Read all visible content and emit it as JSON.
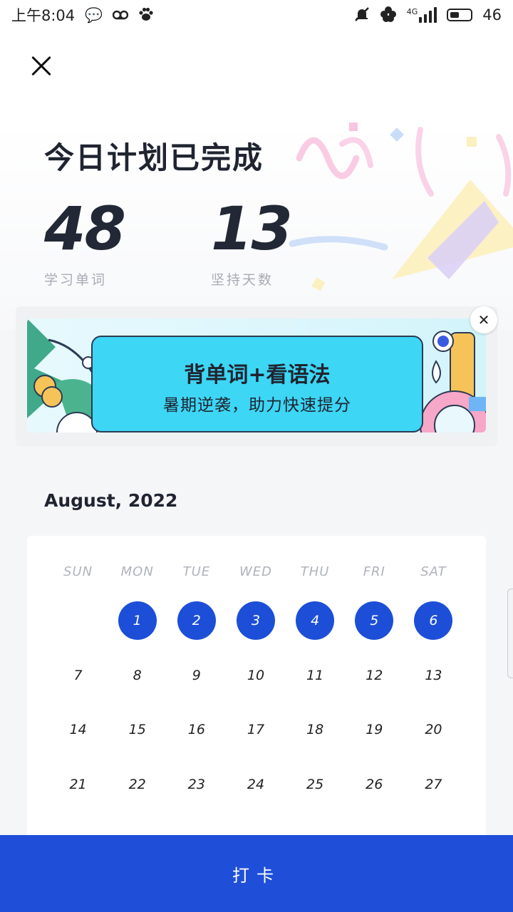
{
  "status_bar": {
    "time": "上午8:04",
    "battery": "46",
    "network": "4G",
    "left_icons": [
      "chat-icon",
      "voicemail-icon",
      "paw-icon"
    ],
    "right_icons": [
      "mute-icon",
      "flower-icon",
      "signal-icon",
      "battery-icon"
    ]
  },
  "header": {
    "title": "今日计划已完成",
    "stats": [
      {
        "value": "48",
        "label": "学习单词"
      },
      {
        "value": "13",
        "label": "坚持天数"
      }
    ]
  },
  "banner": {
    "title": "背单词+看语法",
    "subtitle": "暑期逆袭，助力快速提分",
    "close_glyph": "✕"
  },
  "calendar": {
    "month_label": "August, 2022",
    "weekdays": [
      "SUN",
      "MON",
      "TUE",
      "WED",
      "THU",
      "FRI",
      "SAT"
    ],
    "days": [
      {
        "d": "",
        "checked": false
      },
      {
        "d": "1",
        "checked": true
      },
      {
        "d": "2",
        "checked": true
      },
      {
        "d": "3",
        "checked": true
      },
      {
        "d": "4",
        "checked": true
      },
      {
        "d": "5",
        "checked": true
      },
      {
        "d": "6",
        "checked": true
      },
      {
        "d": "7",
        "checked": false
      },
      {
        "d": "8",
        "checked": false
      },
      {
        "d": "9",
        "checked": false
      },
      {
        "d": "10",
        "checked": false
      },
      {
        "d": "11",
        "checked": false
      },
      {
        "d": "12",
        "checked": false
      },
      {
        "d": "13",
        "checked": false
      },
      {
        "d": "14",
        "checked": false
      },
      {
        "d": "15",
        "checked": false
      },
      {
        "d": "16",
        "checked": false
      },
      {
        "d": "17",
        "checked": false
      },
      {
        "d": "18",
        "checked": false
      },
      {
        "d": "19",
        "checked": false
      },
      {
        "d": "20",
        "checked": false
      },
      {
        "d": "21",
        "checked": false
      },
      {
        "d": "22",
        "checked": false
      },
      {
        "d": "23",
        "checked": false
      },
      {
        "d": "24",
        "checked": false
      },
      {
        "d": "25",
        "checked": false
      },
      {
        "d": "26",
        "checked": false
      },
      {
        "d": "27",
        "checked": false
      }
    ]
  },
  "action": {
    "checkin_label": "打卡"
  },
  "colors": {
    "accent": "#1f4fd8",
    "checked_day": "#1d4ed8",
    "banner_card": "#3dd6f5"
  }
}
